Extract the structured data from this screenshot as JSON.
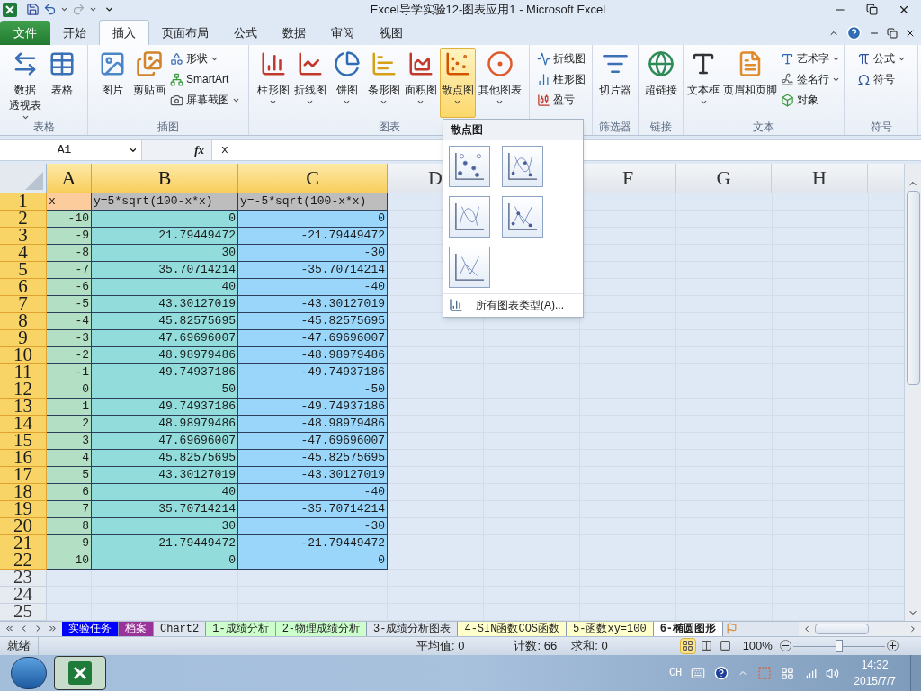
{
  "window": {
    "title": "Excel导学实验12-图表应用1  -  Microsoft Excel"
  },
  "ribbon_tabs": [
    {
      "label": "文件",
      "kind": "file",
      "selected": false
    },
    {
      "label": "开始",
      "kind": "tab",
      "selected": false
    },
    {
      "label": "插入",
      "kind": "tab",
      "selected": true
    },
    {
      "label": "页面布局",
      "kind": "tab",
      "selected": false
    },
    {
      "label": "公式",
      "kind": "tab",
      "selected": false
    },
    {
      "label": "数据",
      "kind": "tab",
      "selected": false
    },
    {
      "label": "审阅",
      "kind": "tab",
      "selected": false
    },
    {
      "label": "视图",
      "kind": "tab",
      "selected": false
    }
  ],
  "ribbon_groups": [
    {
      "label": "表格",
      "items": [
        {
          "lines": [
            "数据",
            "透视表"
          ],
          "kind": "large",
          "dropdown": true,
          "selected": false
        },
        {
          "label": "表格",
          "kind": "large",
          "dropdown": false,
          "selected": false
        }
      ]
    },
    {
      "label": "插图",
      "items": [
        {
          "label": "图片",
          "kind": "large",
          "dropdown": false,
          "selected": false
        },
        {
          "label": "剪贴画",
          "kind": "large",
          "dropdown": false,
          "selected": false
        },
        {
          "label": "形状",
          "kind": "small",
          "dropdown": true,
          "selected": false
        },
        {
          "label": "SmartArt",
          "kind": "small",
          "dropdown": false,
          "selected": false
        },
        {
          "label": "屏幕截图",
          "kind": "small",
          "dropdown": true,
          "selected": false
        }
      ]
    },
    {
      "label": "图表",
      "items": [
        {
          "label": "柱形图",
          "kind": "large",
          "dropdown": true,
          "selected": false
        },
        {
          "label": "折线图",
          "kind": "large",
          "dropdown": true,
          "selected": false
        },
        {
          "label": "饼图",
          "kind": "large",
          "dropdown": true,
          "selected": false
        },
        {
          "label": "条形图",
          "kind": "large",
          "dropdown": true,
          "selected": false
        },
        {
          "label": "面积图",
          "kind": "large",
          "dropdown": true,
          "selected": false
        },
        {
          "label": "散点图",
          "kind": "large",
          "dropdown": true,
          "selected": true
        },
        {
          "label": "其他图表",
          "kind": "large",
          "dropdown": true,
          "selected": false
        }
      ]
    },
    {
      "items": [
        {
          "label": "折线图",
          "kind": "small",
          "dropdown": false,
          "selected": false
        },
        {
          "label": "柱形图",
          "kind": "small",
          "dropdown": false,
          "selected": false
        },
        {
          "label": "盈亏",
          "kind": "small",
          "dropdown": false,
          "selected": false
        }
      ]
    },
    {
      "label": "筛选器",
      "items": [
        {
          "label": "切片器",
          "kind": "large",
          "dropdown": false,
          "selected": false
        }
      ]
    },
    {
      "label": "链接",
      "items": [
        {
          "label": "超链接",
          "kind": "large",
          "dropdown": false,
          "selected": false
        }
      ]
    },
    {
      "label": "文本",
      "items": [
        {
          "label": "文本框",
          "kind": "large",
          "dropdown": true,
          "selected": false
        },
        {
          "label": "页眉和页脚",
          "kind": "large",
          "dropdown": false,
          "selected": false
        },
        {
          "label": "艺术字",
          "kind": "small",
          "dropdown": true,
          "selected": false
        },
        {
          "label": "签名行",
          "kind": "small",
          "dropdown": true,
          "selected": false
        },
        {
          "label": "对象",
          "kind": "small",
          "dropdown": false,
          "selected": false
        }
      ]
    },
    {
      "label": "符号",
      "items": [
        {
          "label": "公式",
          "kind": "small",
          "dropdown": true,
          "selected": false
        },
        {
          "label": "符号",
          "kind": "small",
          "dropdown": false,
          "selected": false
        }
      ]
    }
  ],
  "scatter_menu": {
    "title": "散点图",
    "footer": "所有图表类型(A)..."
  },
  "formula_bar": {
    "name_box": "A1",
    "function_label": "fx",
    "formula": "x"
  },
  "columns": [
    {
      "label": "A",
      "selected": true,
      "color": "#b3dfc4"
    },
    {
      "label": "B",
      "selected": true,
      "color": "#93dcdc"
    },
    {
      "label": "C",
      "selected": true,
      "color": "#9ad6fa"
    },
    {
      "label": "D",
      "selected": false
    },
    {
      "label": "F",
      "selected": false
    },
    {
      "label": "G",
      "selected": false
    },
    {
      "label": "H",
      "selected": false
    }
  ],
  "rows": [
    {
      "number": "1",
      "selected": true,
      "kind": "header",
      "cells": [
        {
          "text": "x",
          "color": "#fdcc9c"
        },
        {
          "text": "y=5*sqrt(100-x*x)",
          "color": "#bdbdbd"
        },
        {
          "text": "y=-5*sqrt(100-x*x)",
          "color": "#bdbdbd"
        }
      ]
    },
    {
      "number": "2",
      "selected": true,
      "kind": "data",
      "cells": [
        "-10",
        "0",
        "0"
      ]
    },
    {
      "number": "3",
      "selected": true,
      "kind": "data",
      "cells": [
        "-9",
        "21.79449472",
        "-21.79449472"
      ]
    },
    {
      "number": "4",
      "selected": true,
      "kind": "data",
      "cells": [
        "-8",
        "30",
        "-30"
      ]
    },
    {
      "number": "5",
      "selected": true,
      "kind": "data",
      "cells": [
        "-7",
        "35.70714214",
        "-35.70714214"
      ]
    },
    {
      "number": "6",
      "selected": true,
      "kind": "data",
      "cells": [
        "-6",
        "40",
        "-40"
      ]
    },
    {
      "number": "7",
      "selected": true,
      "kind": "data",
      "cells": [
        "-5",
        "43.30127019",
        "-43.30127019"
      ]
    },
    {
      "number": "8",
      "selected": true,
      "kind": "data",
      "cells": [
        "-4",
        "45.82575695",
        "-45.82575695"
      ]
    },
    {
      "number": "9",
      "selected": true,
      "kind": "data",
      "cells": [
        "-3",
        "47.69696007",
        "-47.69696007"
      ]
    },
    {
      "number": "10",
      "selected": true,
      "kind": "data",
      "cells": [
        "-2",
        "48.98979486",
        "-48.98979486"
      ]
    },
    {
      "number": "11",
      "selected": true,
      "kind": "data",
      "cells": [
        "-1",
        "49.74937186",
        "-49.74937186"
      ]
    },
    {
      "number": "12",
      "selected": true,
      "kind": "data",
      "cells": [
        "0",
        "50",
        "-50"
      ]
    },
    {
      "number": "13",
      "selected": true,
      "kind": "data",
      "cells": [
        "1",
        "49.74937186",
        "-49.74937186"
      ]
    },
    {
      "number": "14",
      "selected": true,
      "kind": "data",
      "cells": [
        "2",
        "48.98979486",
        "-48.98979486"
      ]
    },
    {
      "number": "15",
      "selected": true,
      "kind": "data",
      "cells": [
        "3",
        "47.69696007",
        "-47.69696007"
      ]
    },
    {
      "number": "16",
      "selected": true,
      "kind": "data",
      "cells": [
        "4",
        "45.82575695",
        "-45.82575695"
      ]
    },
    {
      "number": "17",
      "selected": true,
      "kind": "data",
      "cells": [
        "5",
        "43.30127019",
        "-43.30127019"
      ]
    },
    {
      "number": "18",
      "selected": true,
      "kind": "data",
      "cells": [
        "6",
        "40",
        "-40"
      ]
    },
    {
      "number": "19",
      "selected": true,
      "kind": "data",
      "cells": [
        "7",
        "35.70714214",
        "-35.70714214"
      ]
    },
    {
      "number": "20",
      "selected": true,
      "kind": "data",
      "cells": [
        "8",
        "30",
        "-30"
      ]
    },
    {
      "number": "21",
      "selected": true,
      "kind": "data",
      "cells": [
        "9",
        "21.79449472",
        "-21.79449472"
      ]
    },
    {
      "number": "22",
      "selected": true,
      "kind": "data",
      "cells": [
        "10",
        "0",
        "0"
      ]
    },
    {
      "number": "23",
      "selected": false,
      "kind": "empty"
    },
    {
      "number": "24",
      "selected": false,
      "kind": "empty"
    },
    {
      "number": "25",
      "selected": false,
      "kind": "empty"
    }
  ],
  "sheet_tabs": [
    {
      "label": "实验任务",
      "selected": false,
      "color": "#0000ff"
    },
    {
      "label": "档案",
      "selected": false,
      "color": "#993399"
    },
    {
      "label": "Chart2",
      "selected": false
    },
    {
      "label": "1-成绩分析",
      "selected": false,
      "color": "#ccffcc"
    },
    {
      "label": "2-物理成绩分析",
      "selected": false,
      "color": "#ccffcc"
    },
    {
      "label": "3-成绩分析图表",
      "selected": false
    },
    {
      "label": "4-SIN函数COS函数",
      "selected": false,
      "color": "#ffffcc"
    },
    {
      "label": "5-函数xy=100",
      "selected": false,
      "color": "#ffffcc"
    },
    {
      "label": "6-椭圆图形",
      "selected": true
    }
  ],
  "status_bar": {
    "ready": "就绪",
    "average": "平均值: 0",
    "count": "计数: 66",
    "sum": "求和: 0",
    "views": [
      {
        "selected": true
      },
      {
        "selected": false
      },
      {
        "selected": false
      }
    ],
    "zoom": "100%",
    "zoom_slider": {
      "level": 0.5
    }
  },
  "taskbar": {
    "language": "CH",
    "time": "14:32",
    "date": "2015/7/7"
  }
}
